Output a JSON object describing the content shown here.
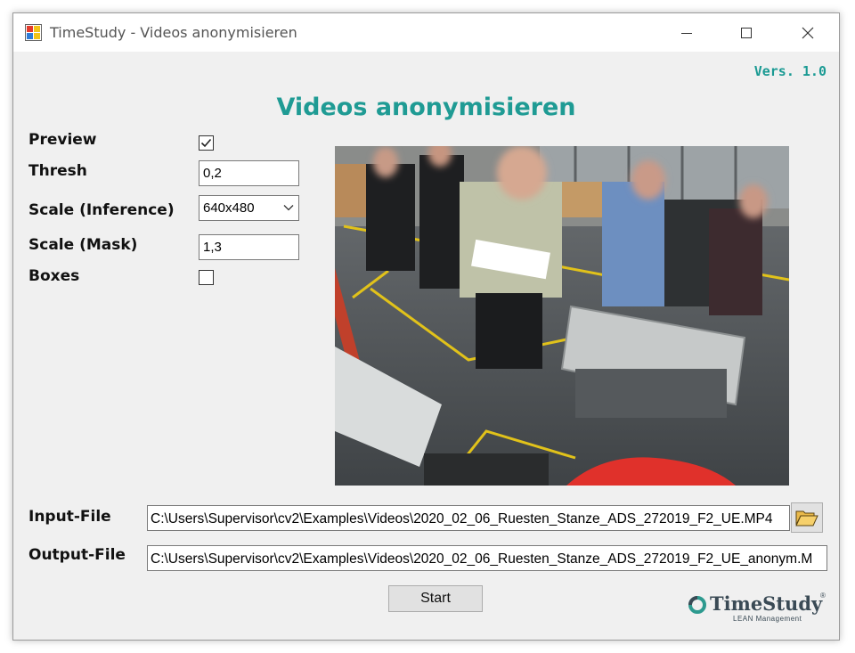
{
  "window": {
    "title": "TimeStudy - Videos anonymisieren",
    "version": "Vers. 1.0",
    "heading": "Videos anonymisieren"
  },
  "settings": {
    "preview_label": "Preview",
    "preview_checked": true,
    "thresh_label": "Thresh",
    "thresh_value": "0,2",
    "scale_inference_label": "Scale (Inference)",
    "scale_inference_value": "640x480",
    "scale_mask_label": "Scale (Mask)",
    "scale_mask_value": "1,3",
    "boxes_label": "Boxes",
    "boxes_checked": false
  },
  "files": {
    "input_label": "Input-File",
    "input_value": "C:\\Users\\Supervisor\\cv2\\Examples\\Videos\\2020_02_06_Ruesten_Stanze_ADS_272019_F2_UE.MP4",
    "output_label": "Output-File",
    "output_value": "C:\\Users\\Supervisor\\cv2\\Examples\\Videos\\2020_02_06_Ruesten_Stanze_ADS_272019_F2_UE_anonym.M"
  },
  "actions": {
    "start_label": "Start"
  },
  "logo": {
    "name": "TimeStudy",
    "tagline": "LEAN Management",
    "reg": "®"
  },
  "colors": {
    "accent": "#1f9b94"
  }
}
